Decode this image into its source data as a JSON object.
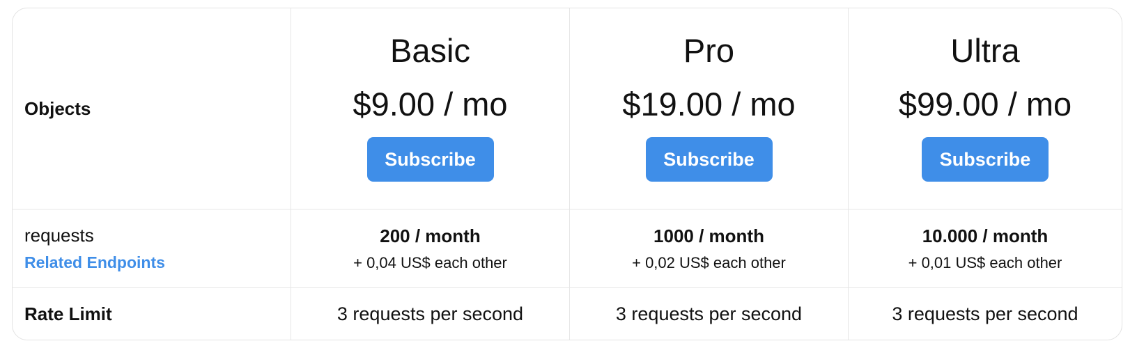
{
  "table": {
    "header_label": "Objects",
    "requests_label": "requests",
    "related_link": "Related Endpoints",
    "rate_limit_label": "Rate Limit"
  },
  "plans": [
    {
      "name": "Basic",
      "price": "$9.00 / mo",
      "button": "Subscribe",
      "quota": "200 / month",
      "overage": "+ 0,04 US$ each other",
      "rate_limit": "3 requests per second"
    },
    {
      "name": "Pro",
      "price": "$19.00 / mo",
      "button": "Subscribe",
      "quota": "1000 / month",
      "overage": "+ 0,02 US$ each other",
      "rate_limit": "3 requests per second"
    },
    {
      "name": "Ultra",
      "price": "$99.00 / mo",
      "button": "Subscribe",
      "quota": "10.000 / month",
      "overage": "+ 0,01 US$ each other",
      "rate_limit": "3 requests per second"
    }
  ],
  "colors": {
    "accent": "#3f8ee8",
    "border": "#e3e3e3",
    "text": "#111111"
  }
}
